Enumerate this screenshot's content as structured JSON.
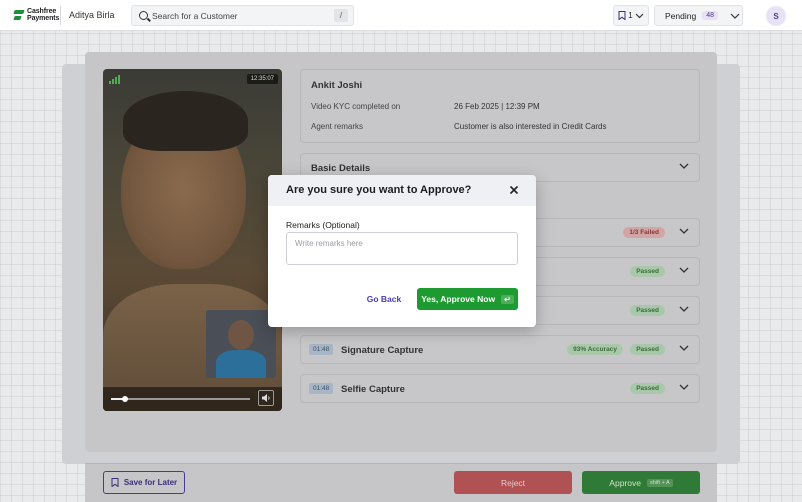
{
  "topbar": {
    "logo_line1": "Cashfree",
    "logo_line2": "Payments",
    "org_name": "Aditya Birla",
    "search_placeholder": "Search for a Customer",
    "search_shortcut": "/",
    "bookmark_count": "1",
    "pending_label": "Pending",
    "pending_count": "48",
    "avatar_initial": "S"
  },
  "video": {
    "timestamp": "12:35:07",
    "progress_fraction": 0.1
  },
  "customer": {
    "name": "Ankit Joshi",
    "kyc_label": "Video KYC completed on",
    "kyc_value": "26 Feb 2025  |  12:39 PM",
    "remarks_label": "Agent remarks",
    "remarks_value": "Customer is also interested in Credit Cards"
  },
  "sections": {
    "basic_details": "Basic Details",
    "check1_status": "1/3 Failed",
    "check2_status": "Passed",
    "check3_status": "Passed",
    "signature": {
      "time": "01:48",
      "title": "Signature Capture",
      "accuracy": "93% Accuracy",
      "status": "Passed"
    },
    "selfie": {
      "time": "01:48",
      "title": "Selfie Capture",
      "status": "Passed"
    }
  },
  "footer": {
    "save_later": "Save for Later",
    "reject": "Reject",
    "approve": "Approve",
    "approve_shortcut": "shift + A"
  },
  "modal": {
    "title": "Are you sure you want to Approve?",
    "remarks_label": "Remarks (Optional)",
    "remarks_placeholder": "Write remarks here",
    "go_back": "Go Back",
    "confirm": "Yes, Approve Now",
    "confirm_key": "↵"
  },
  "colors": {
    "brand_green": "#1e9b30",
    "accent_purple": "#4a3cba",
    "reject_red": "#d9534f"
  }
}
